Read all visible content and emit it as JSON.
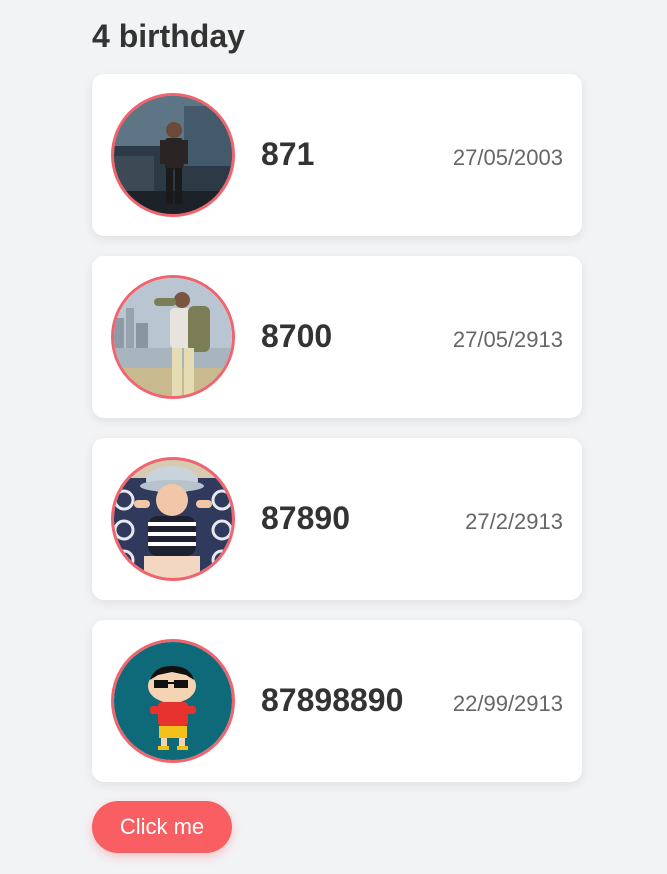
{
  "page": {
    "heading": "4 birthday"
  },
  "people": [
    {
      "name": "871",
      "date": "27/05/2003",
      "avatar": "photo-man-standing-street-icon"
    },
    {
      "name": "8700",
      "date": "27/05/2913",
      "avatar": "photo-man-seaside-icon"
    },
    {
      "name": "87890",
      "date": "27/2/2913",
      "avatar": "photo-baby-hat-icon"
    },
    {
      "name": "87898890",
      "date": "22/99/2913",
      "avatar": "cartoon-boy-sunglasses-icon"
    }
  ],
  "button": {
    "label": "Click me"
  },
  "colors": {
    "background": "#f2f3f5",
    "card": "#ffffff",
    "avatar_border": "#f2646d",
    "button": "#f95f62",
    "text": "#333333",
    "date_text": "#666666"
  }
}
